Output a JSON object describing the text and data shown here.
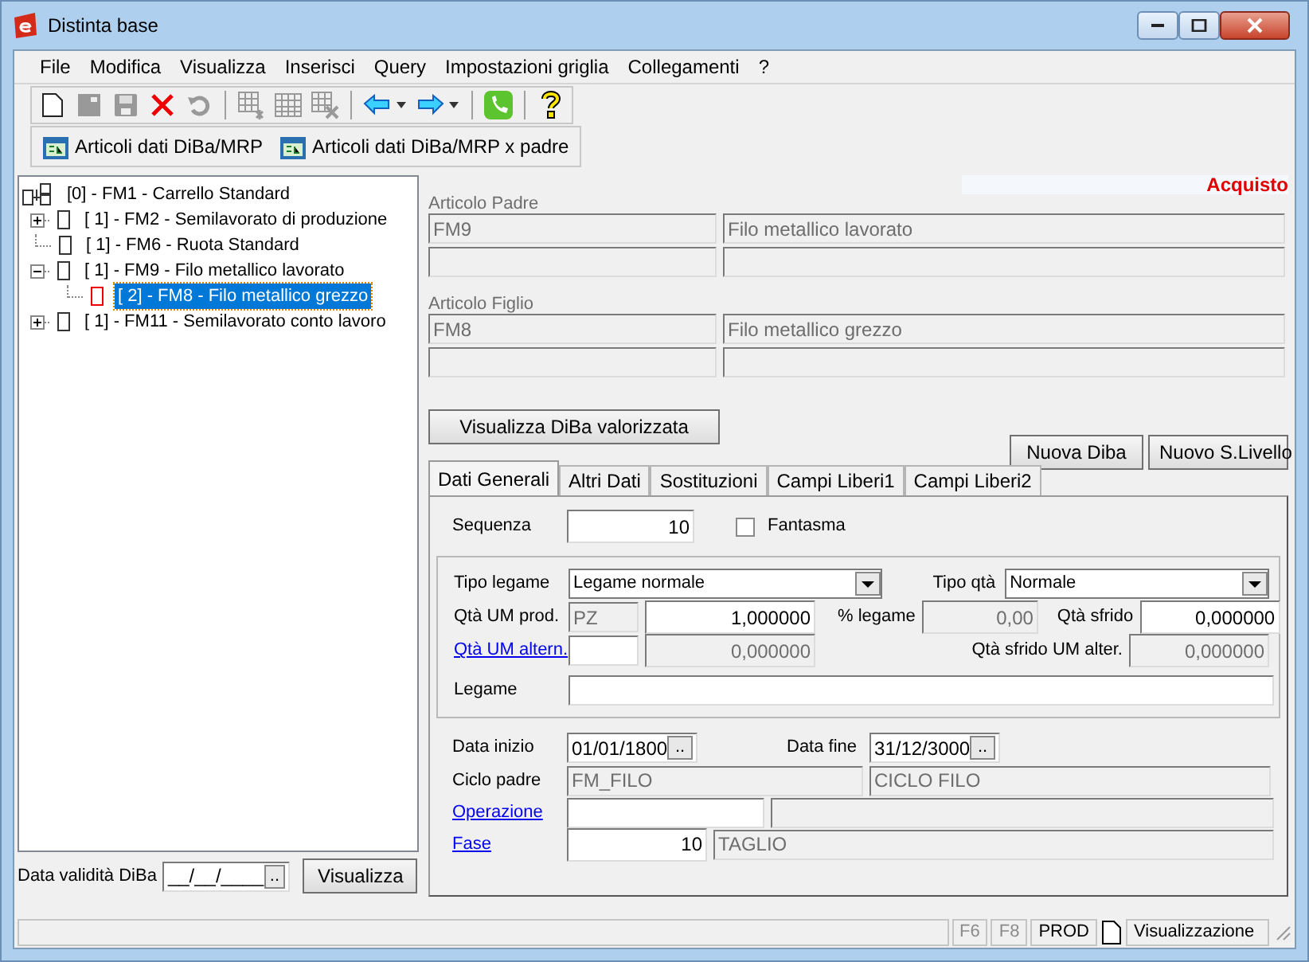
{
  "window": {
    "title": "Distinta base"
  },
  "menu": [
    {
      "label": "File"
    },
    {
      "label": "Modifica"
    },
    {
      "label": "Visualizza"
    },
    {
      "label": "Inserisci"
    },
    {
      "label": "Query"
    },
    {
      "label": "Impostazioni griglia"
    },
    {
      "label": "Collegamenti"
    },
    {
      "label": "?"
    }
  ],
  "toolbar": [
    {
      "kind": "new",
      "disabled": false
    },
    {
      "kind": "page",
      "disabled": true
    },
    {
      "kind": "save",
      "disabled": true
    },
    {
      "kind": "delete",
      "disabled": false
    },
    {
      "kind": "undo",
      "disabled": true
    },
    {
      "kind": "sep"
    },
    {
      "kind": "grid-add",
      "disabled": true
    },
    {
      "kind": "grid",
      "disabled": true
    },
    {
      "kind": "grid-delete",
      "disabled": true
    },
    {
      "kind": "sep"
    },
    {
      "kind": "back",
      "disabled": false
    },
    {
      "kind": "forward",
      "disabled": false
    },
    {
      "kind": "sep"
    },
    {
      "kind": "phone",
      "disabled": false
    },
    {
      "kind": "sep"
    },
    {
      "kind": "help",
      "disabled": false
    }
  ],
  "toolbar2": [
    {
      "label": "Articoli dati DiBa/MRP"
    },
    {
      "label": "Articoli dati DiBa/MRP x padre"
    }
  ],
  "tree": [
    {
      "label": "[0] - FM1 - Carrello Standard",
      "selected": false,
      "children": [
        {
          "label": "[ 1] - FM2 - Semilavorato di produzione",
          "selected": false,
          "expanded": false
        },
        {
          "label": "[ 1] - FM6 - Ruota Standard",
          "selected": false
        },
        {
          "label": "[ 1] - FM9 - Filo metallico lavorato",
          "selected": false,
          "expanded": true,
          "children": [
            {
              "label": "[ 2] - FM8 - Filo metallico grezzo",
              "selected": true
            }
          ]
        },
        {
          "label": "[ 1] - FM11 - Semilavorato conto lavoro",
          "selected": false,
          "expanded": false
        }
      ]
    }
  ],
  "validity": {
    "label": "Data validità DiBa",
    "value": "__/__/____",
    "picker": "..",
    "button": "Visualizza"
  },
  "category": "Acquisto",
  "articles": [
    {
      "label": "Articolo Padre",
      "code": "FM9",
      "description": "Filo metallico lavorato"
    },
    {
      "label": "Articolo Figlio",
      "code": "FM8",
      "description": "Filo metallico grezzo"
    }
  ],
  "buttons": {
    "valorizzata": "Visualizza DiBa valorizzata",
    "nuova": "Nuova Diba",
    "livello": "Nuovo S.Livello"
  },
  "tabs": [
    {
      "label": "Dati Generali",
      "selected": true
    },
    {
      "label": "Altri Dati",
      "selected": false
    },
    {
      "label": "Sostituzioni",
      "selected": false
    },
    {
      "label": "Campi Liberi1",
      "selected": false
    },
    {
      "label": "Campi Liberi2",
      "selected": false
    }
  ],
  "form": {
    "sequenza": {
      "label": "Sequenza",
      "value": "10",
      "disabled": false
    },
    "fantasma": {
      "label": "Fantasma",
      "checked": false
    },
    "tipo_legame": {
      "label": "Tipo legame",
      "value": "Legame normale"
    },
    "tipo_qta": {
      "label": "Tipo qtà",
      "value": "Normale"
    },
    "qta_um_prod": {
      "label": "Qtà UM prod.",
      "link": false,
      "fields": [
        {
          "value": "PZ",
          "disabled": true
        },
        {
          "value": "1,000000",
          "disabled": false
        }
      ]
    },
    "perc_legame": {
      "label": "% legame",
      "value": "0,00",
      "disabled": true
    },
    "qta_sfrido": {
      "label": "Qtà sfrido",
      "value": "0,000000",
      "disabled": false
    },
    "qta_um_altern": {
      "label": "Qtà UM altern.",
      "link": true,
      "fields": [
        {
          "disabled": false
        },
        {
          "value": "0,000000",
          "disabled": true
        }
      ]
    },
    "qta_sfrido_um_alter": {
      "label": "Qtà sfrido UM alter.",
      "value": "0,000000",
      "disabled": true
    },
    "legame": {
      "label": "Legame",
      "disabled": false
    },
    "data_inizio": {
      "label": "Data inizio",
      "value": "01/01/1800",
      "picker": ".."
    },
    "data_fine": {
      "label": "Data fine",
      "value": "31/12/3000",
      "picker": ".."
    },
    "ciclo_padre": {
      "label": "Ciclo padre",
      "link": false,
      "fields": [
        {
          "value": "FM_FILO",
          "disabled": true
        },
        {
          "value": "CICLO FILO",
          "disabled": true
        }
      ]
    },
    "operazione": {
      "label": "Operazione",
      "link": true,
      "fields": [
        {
          "disabled": false
        },
        {
          "disabled": true
        }
      ]
    },
    "fase": {
      "label": "Fase",
      "link": true,
      "fields": [
        {
          "value": "10",
          "disabled": false
        },
        {
          "value": "TAGLIO",
          "disabled": true
        }
      ]
    }
  },
  "status_bar": [
    {
      "kind": "text",
      "label": "F6",
      "disabled": true
    },
    {
      "kind": "text",
      "label": "F8",
      "disabled": true
    },
    {
      "kind": "text",
      "label": "PROD",
      "disabled": false
    },
    {
      "kind": "doc"
    },
    {
      "kind": "text",
      "label": "Visualizzazione",
      "disabled": false
    }
  ]
}
